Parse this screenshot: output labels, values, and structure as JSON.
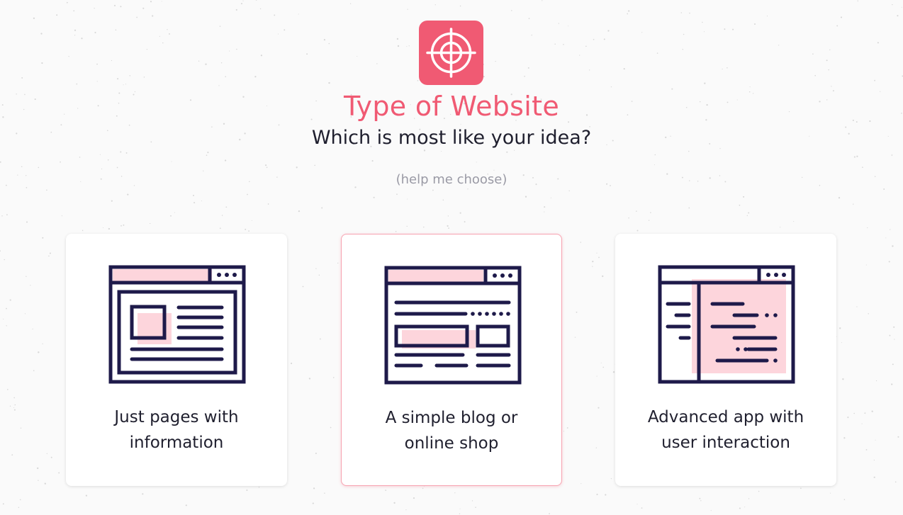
{
  "header": {
    "title": "Type of Website",
    "subtitle": "Which is most like your idea?",
    "help_link": "(help me choose)",
    "logo_icon": "crosshair-icon"
  },
  "options": [
    {
      "line1": "Just pages with",
      "line2": "information",
      "icon": "info-pages-icon",
      "selected": false
    },
    {
      "line1": "A simple blog or",
      "line2": "online shop",
      "icon": "blog-shop-icon",
      "selected": true
    },
    {
      "line1": "Advanced app with",
      "line2": "user interaction",
      "icon": "advanced-app-icon",
      "selected": false
    }
  ],
  "colors": {
    "accent": "#f05a73",
    "navy": "#1e1a4a",
    "pink_fill": "#fdd5dc",
    "text": "#1f1f2e",
    "muted": "#9a9aa5"
  }
}
